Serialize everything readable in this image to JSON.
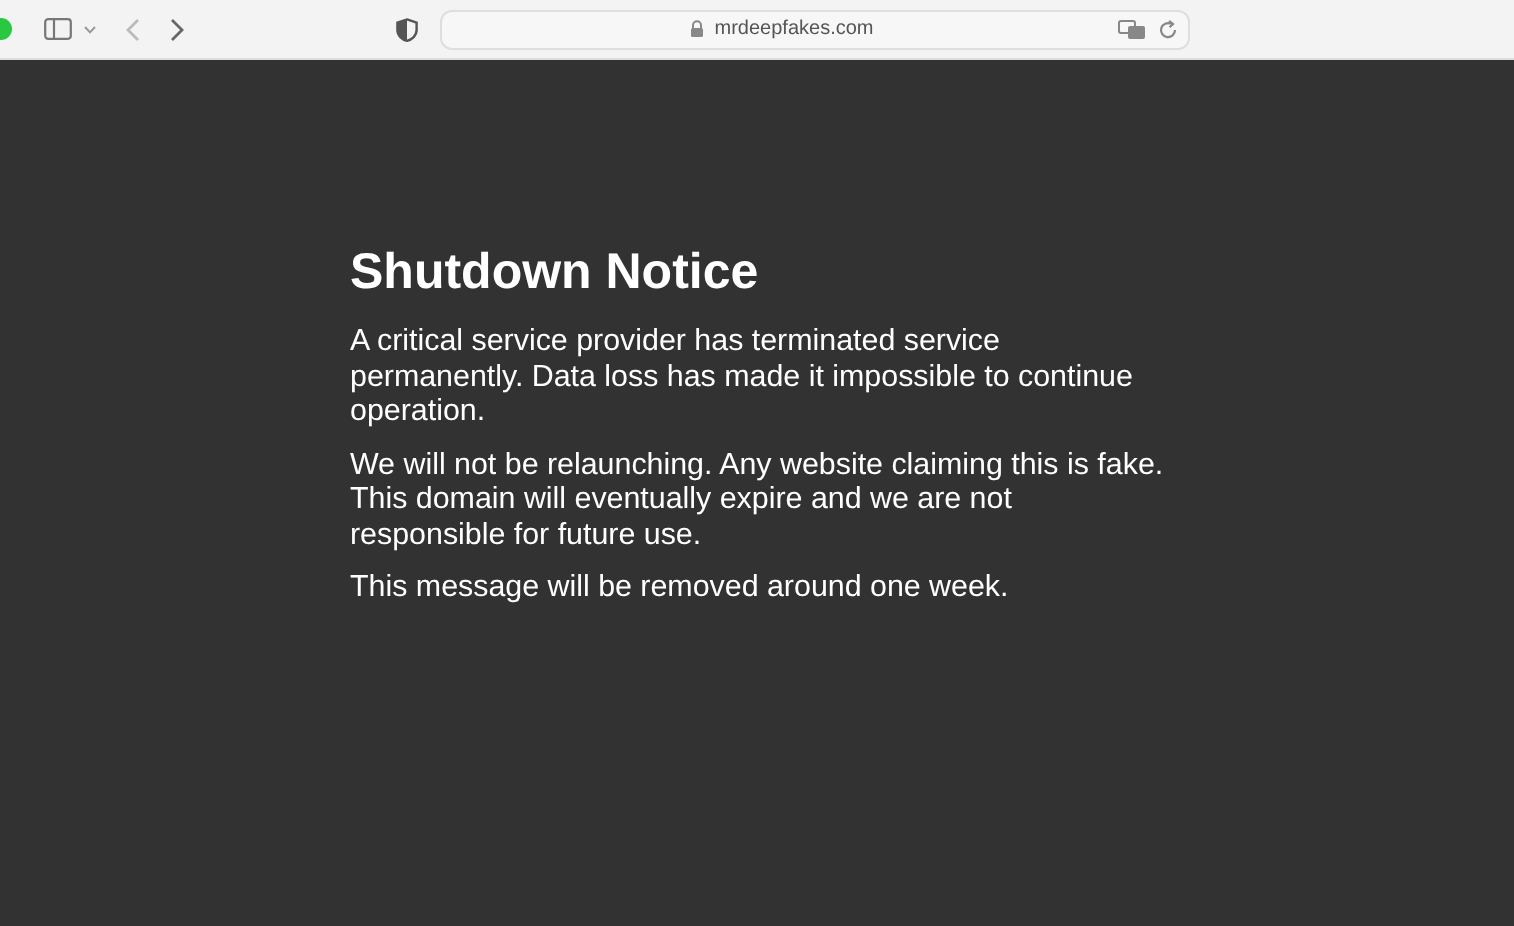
{
  "browser": {
    "address": "mrdeepfakes.com"
  },
  "page": {
    "title": "Shutdown Notice",
    "paragraphs": [
      "A critical service provider has terminated service permanently. Data loss has made it impossible to continue operation.",
      "We will not be relaunching. Any website claiming this is fake. This domain will eventually expire and we are not responsible for future use.",
      "This message will be removed around one week."
    ]
  }
}
